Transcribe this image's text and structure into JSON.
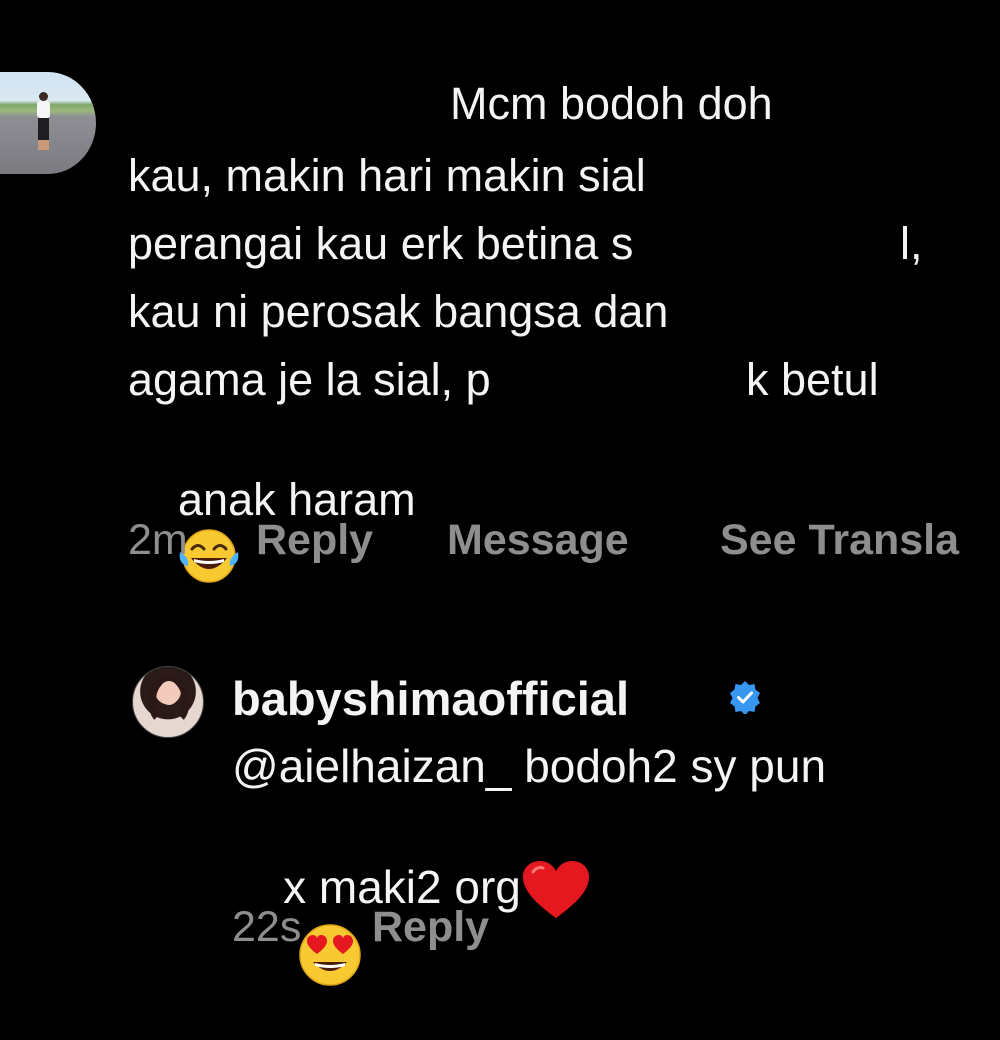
{
  "comment1": {
    "lines": [
      "Mcm bodoh doh",
      "kau, makin hari makin sial",
      "perangai kau erk betina s",
      "l,",
      "kau ni perosak bangsa dan",
      "agama je la sial, p",
      "k betul",
      "anak haram"
    ],
    "emoji": "tears-of-joy-emoji",
    "time": "2m",
    "actions": [
      "Reply",
      "Message",
      "See Transla"
    ]
  },
  "comment2": {
    "username": "babyshimaofficial",
    "verified": true,
    "line1": "@aielhaizan_ bodoh2 sy pun",
    "line2": "x maki2 org",
    "emojis": [
      "red-heart-emoji",
      "heart-eyes-emoji"
    ],
    "time": "22s",
    "action": "Reply"
  },
  "colors": {
    "background": "#000000",
    "text": "#f4f4f4",
    "meta": "#8e8e8e",
    "verified": "#3797f0"
  }
}
